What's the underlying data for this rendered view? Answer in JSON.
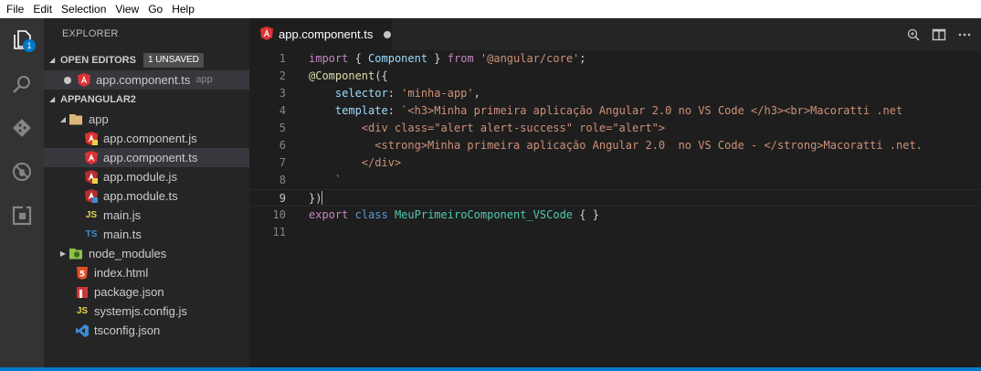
{
  "menu": [
    "File",
    "Edit",
    "Selection",
    "View",
    "Go",
    "Help"
  ],
  "activity": {
    "explorer_badge": "1"
  },
  "sidebar": {
    "title": "EXPLORER",
    "open_editors": {
      "label": "OPEN EDITORS",
      "badge": "1 UNSAVED",
      "file": "app.component.ts",
      "desc": "app"
    },
    "project": {
      "label": "APPANGULAR2"
    },
    "tree": [
      {
        "name": "app",
        "type": "folder-open"
      },
      {
        "name": "app.component.js",
        "type": "angular-js"
      },
      {
        "name": "app.component.ts",
        "type": "angular-ts"
      },
      {
        "name": "app.module.js",
        "type": "angular-js"
      },
      {
        "name": "app.module.ts",
        "type": "angular-ts"
      },
      {
        "name": "main.js",
        "type": "js",
        "icon_text": "JS"
      },
      {
        "name": "main.ts",
        "type": "ts",
        "icon_text": "TS"
      },
      {
        "name": "node_modules",
        "type": "folder-closed"
      },
      {
        "name": "index.html",
        "type": "html",
        "icon_text": "5"
      },
      {
        "name": "package.json",
        "type": "json"
      },
      {
        "name": "systemjs.config.js",
        "type": "js",
        "icon_text": "JS"
      },
      {
        "name": "tsconfig.json",
        "type": "tsconfig"
      }
    ]
  },
  "tab": {
    "label": "app.component.ts",
    "modified": true
  },
  "editor": {
    "line_numbers": [
      "1",
      "2",
      "3",
      "4",
      "5",
      "6",
      "7",
      "8",
      "9",
      "10",
      "11"
    ],
    "lines": [
      [
        {
          "t": "import",
          "c": "kw2"
        },
        {
          "t": " { ",
          "c": "pl"
        },
        {
          "t": "Component",
          "c": "var"
        },
        {
          "t": " } ",
          "c": "pl"
        },
        {
          "t": "from",
          "c": "kw2"
        },
        {
          "t": " ",
          "c": "pl"
        },
        {
          "t": "'@angular/core'",
          "c": "str"
        },
        {
          "t": ";",
          "c": "pl"
        }
      ],
      [
        {
          "t": "@Component",
          "c": "dec"
        },
        {
          "t": "({",
          "c": "pl"
        }
      ],
      [
        {
          "t": "    selector",
          "c": "var"
        },
        {
          "t": ": ",
          "c": "pl"
        },
        {
          "t": "'minha-app'",
          "c": "str"
        },
        {
          "t": ",",
          "c": "pl"
        }
      ],
      [
        {
          "t": "    template",
          "c": "var"
        },
        {
          "t": ": ",
          "c": "pl"
        },
        {
          "t": "`<h3>Minha primeira aplicação Angular 2.0 no VS Code </h3><br>Macoratti .net",
          "c": "str"
        }
      ],
      [
        {
          "t": "        <div class=\"alert alert-success\" role=\"alert\">",
          "c": "str"
        }
      ],
      [
        {
          "t": "          <strong>Minha primeira aplicação Angular 2.0  no VS Code - </strong>Macoratti .net.",
          "c": "str"
        }
      ],
      [
        {
          "t": "        </div>",
          "c": "str"
        }
      ],
      [
        {
          "t": "    `",
          "c": "str"
        }
      ],
      [
        {
          "t": "})",
          "c": "pl"
        }
      ],
      [
        {
          "t": "export",
          "c": "kw2"
        },
        {
          "t": " ",
          "c": "pl"
        },
        {
          "t": "class",
          "c": "kw"
        },
        {
          "t": " ",
          "c": "pl"
        },
        {
          "t": "MeuPrimeiroComponent_VSCode",
          "c": "typ"
        },
        {
          "t": " { }",
          "c": "pl"
        }
      ],
      []
    ],
    "current_line": 9
  },
  "colors": {
    "accent": "#007acc",
    "angular": "#dd3333",
    "js": "#e8d44d",
    "ts": "#3c8cd6",
    "html": "#e44d26"
  }
}
